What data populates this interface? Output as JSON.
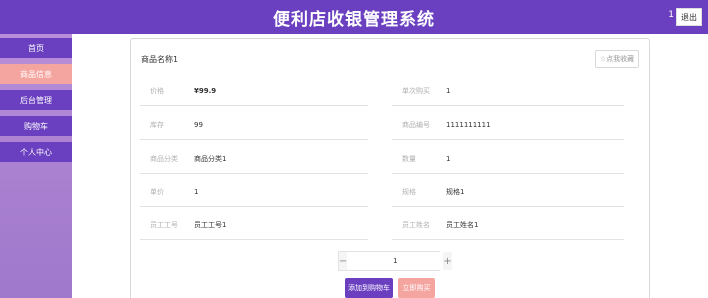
{
  "header": {
    "title": "便利店收银管理系统",
    "user": "1",
    "logout_label": "退出"
  },
  "sidebar": {
    "items": [
      {
        "label": "首页"
      },
      {
        "label": "商品信息"
      },
      {
        "label": "后台管理"
      },
      {
        "label": "购物车"
      },
      {
        "label": "个人中心"
      }
    ]
  },
  "product": {
    "name": "商品名称1",
    "favorite_label": "☆点我收藏",
    "fields": {
      "price": {
        "label": "价格",
        "value": "¥99.9"
      },
      "limit": {
        "label": "单次购买",
        "value": "1"
      },
      "stock": {
        "label": "库存",
        "value": "99"
      },
      "code": {
        "label": "商品编号",
        "value": "1111111111"
      },
      "category": {
        "label": "商品分类",
        "value": "商品分类1"
      },
      "quantity": {
        "label": "数量",
        "value": "1"
      },
      "unit_price": {
        "label": "单价",
        "value": "1"
      },
      "spec": {
        "label": "规格",
        "value": "规格1"
      },
      "staff_id": {
        "label": "员工工号",
        "value": "员工工号1"
      },
      "staff_name": {
        "label": "员工姓名",
        "value": "员工姓名1"
      }
    }
  },
  "purchase": {
    "minus": "−",
    "plus": "+",
    "qty": "1",
    "add_to_cart_label": "添加到购物车",
    "buy_now_label": "立即购买"
  },
  "colors": {
    "primary": "#6a3fc0",
    "accent": "#f5a5a0",
    "sidebar": "#b88fd8"
  }
}
